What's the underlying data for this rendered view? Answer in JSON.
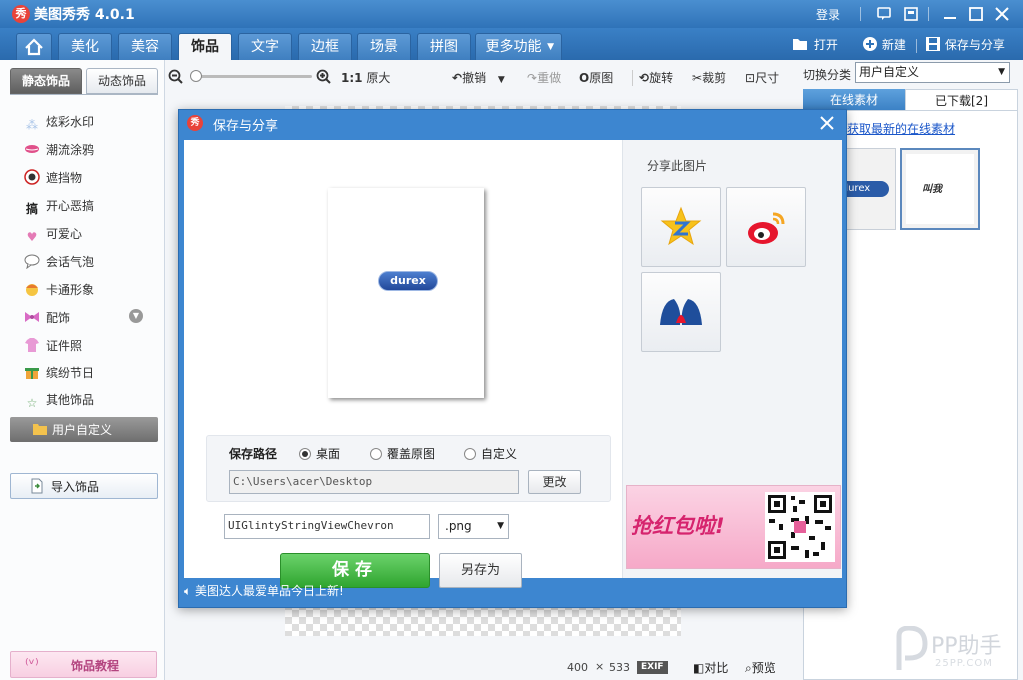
{
  "app": {
    "title": "美图秀秀 4.0.1",
    "logo_char": "秀",
    "login": "登录"
  },
  "nav": {
    "tabs": [
      "美化",
      "美容",
      "饰品",
      "文字",
      "边框",
      "场景",
      "拼图",
      "更多功能"
    ],
    "active": "饰品",
    "open_label": "打开",
    "new_label": "新建",
    "share_label": "保存与分享"
  },
  "toolbar": {
    "zoom_original_ratio": "1:1",
    "zoom_original_label": "原大",
    "undo": "撤销",
    "redo": "重做",
    "original": "原图",
    "rotate": "旋转",
    "crop": "裁剪",
    "size": "尺寸"
  },
  "sidebar": {
    "tab_static": "静态饰品",
    "tab_dynamic": "动态饰品",
    "items": [
      {
        "label": "炫彩水印",
        "icon": "sparkle-icon"
      },
      {
        "label": "潮流涂鸦",
        "icon": "lips-icon"
      },
      {
        "label": "遮挡物",
        "icon": "mask-icon"
      },
      {
        "label": "开心恶搞",
        "icon": "prank-icon",
        "icon_text": "搞"
      },
      {
        "label": "可爱心",
        "icon": "heart-icon"
      },
      {
        "label": "会话气泡",
        "icon": "speech-bubble-icon"
      },
      {
        "label": "卡通形象",
        "icon": "cartoon-icon"
      },
      {
        "label": "配饰",
        "icon": "bow-icon"
      },
      {
        "label": "证件照",
        "icon": "shirt-icon"
      },
      {
        "label": "缤纷节日",
        "icon": "gift-icon"
      },
      {
        "label": "其他饰品",
        "icon": "star-outline-icon"
      }
    ],
    "custom": "用户自定义",
    "import": "导入饰品",
    "tutorial": "饰品教程"
  },
  "right_panel": {
    "category_label": "切换分类",
    "category_value": "用户自定义",
    "tab_online": "在线素材",
    "tab_downloaded": "已下载[2]",
    "link": "获取最新的在线素材",
    "thumb1_text": "durex",
    "thumb2_text": "叫我"
  },
  "dialog": {
    "title": "保存与分享",
    "preview_logo": "durex",
    "share_title": "分享此图片",
    "path_label": "保存路径",
    "opt_desktop": "桌面",
    "opt_overwrite": "覆盖原图",
    "opt_custom": "自定义",
    "path_value": "C:\\Users\\acer\\Desktop",
    "change_btn": "更改",
    "filename": "UIGlintyStringViewChevron",
    "format": ".png",
    "save_btn": "保存",
    "saveas_btn": "另存为",
    "footer": "美图达人最爱单品今日上新!",
    "ad_text": "抢红包啦!"
  },
  "status": {
    "width": "400",
    "times": "×",
    "height": "533",
    "exif": "EXIF",
    "compare": "对比",
    "preview": "预览"
  },
  "watermark": {
    "text": "PP助手",
    "sub": "25PP.COM"
  },
  "colors": {
    "title_blue": "#2f73b8",
    "accent_green": "#2fa52f",
    "link_blue": "#1a56c9"
  }
}
